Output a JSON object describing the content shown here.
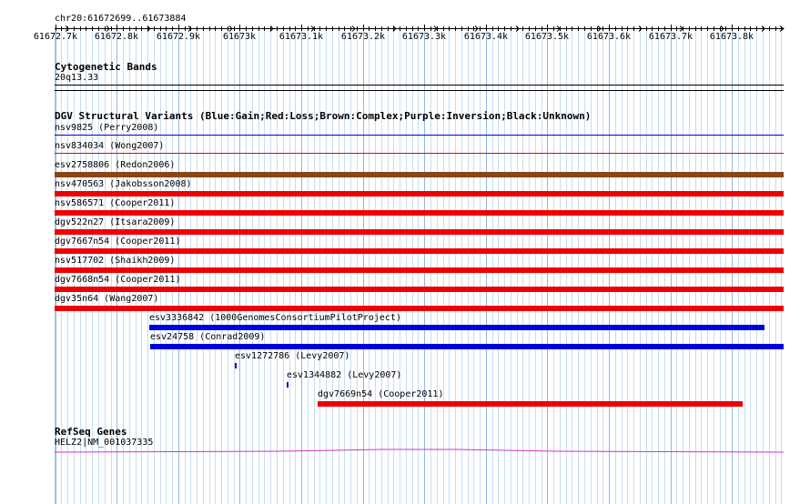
{
  "ruler": {
    "region": "chr20:61672699..61673884",
    "start": 61672699,
    "end": 61673884,
    "ticks": [
      "61672.7k",
      "61672.8k",
      "61672.9k",
      "61673k",
      "61673.1k",
      "61673.2k",
      "61673.3k",
      "61673.4k",
      "61673.5k",
      "61673.6k",
      "61673.7k",
      "61673.8k"
    ]
  },
  "cytoband": {
    "title": "Cytogenetic Bands",
    "band": "20q13.33"
  },
  "dgv": {
    "title": "DGV Structural Variants (Blue:Gain;Red:Loss;Brown:Complex;Purple:Inversion;Black:Unknown)",
    "colors": {
      "gain": "#0000dd",
      "loss": "#ee0000",
      "complex": "#8b4513",
      "inversion": "#800080",
      "unknown": "#000000"
    },
    "variants": [
      {
        "label": "nsv9825 (Perry2008)",
        "type": "gain",
        "start": 61672699,
        "end": 61673884
      },
      {
        "label": "nsv834034 (Wong2007)",
        "type": "loss",
        "start": 61672699,
        "end": 61673884
      },
      {
        "label": "esv2758806 (Redon2006)",
        "type": "complex",
        "start": 61672699,
        "end": 61673884
      },
      {
        "label": "nsv470563 (Jakobsson2008)",
        "type": "loss",
        "start": 61672699,
        "end": 61673884
      },
      {
        "label": "nsv586571 (Cooper2011)",
        "type": "loss",
        "start": 61672699,
        "end": 61673884
      },
      {
        "label": "dgv522n27 (Itsara2009)",
        "type": "loss",
        "start": 61672699,
        "end": 61673884
      },
      {
        "label": "dgv7667n54 (Cooper2011)",
        "type": "loss",
        "start": 61672699,
        "end": 61673884
      },
      {
        "label": "nsv517702 (Shaikh2009)",
        "type": "loss",
        "start": 61672699,
        "end": 61673884
      },
      {
        "label": "dgv7668n54 (Cooper2011)",
        "type": "loss",
        "start": 61672699,
        "end": 61673884
      },
      {
        "label": "dgv35n64 (Wang2007)",
        "type": "loss",
        "start": 61672699,
        "end": 61673884
      },
      {
        "label": "esv3336842 (1000GenomesConsortiumPilotProject)",
        "type": "gain",
        "start": 61672853,
        "end": 61673853
      },
      {
        "label": "esv24758 (Conrad2009)",
        "type": "gain",
        "start": 61672855,
        "end": 61673884
      },
      {
        "label": "esv1272786 (Levy2007)",
        "type": "gain",
        "start": 61672992,
        "end": 61672993
      },
      {
        "label": "esv1344882 (Levy2007)",
        "type": "gain",
        "start": 61673076,
        "end": 61673077
      },
      {
        "label": "dgv7669n54 (Cooper2011)",
        "type": "loss",
        "start": 61673126,
        "end": 61673817
      }
    ]
  },
  "refseq": {
    "title": "RefSeq Genes",
    "gene": "HELZ2|NM_001037335",
    "color": "#cc33cc"
  }
}
